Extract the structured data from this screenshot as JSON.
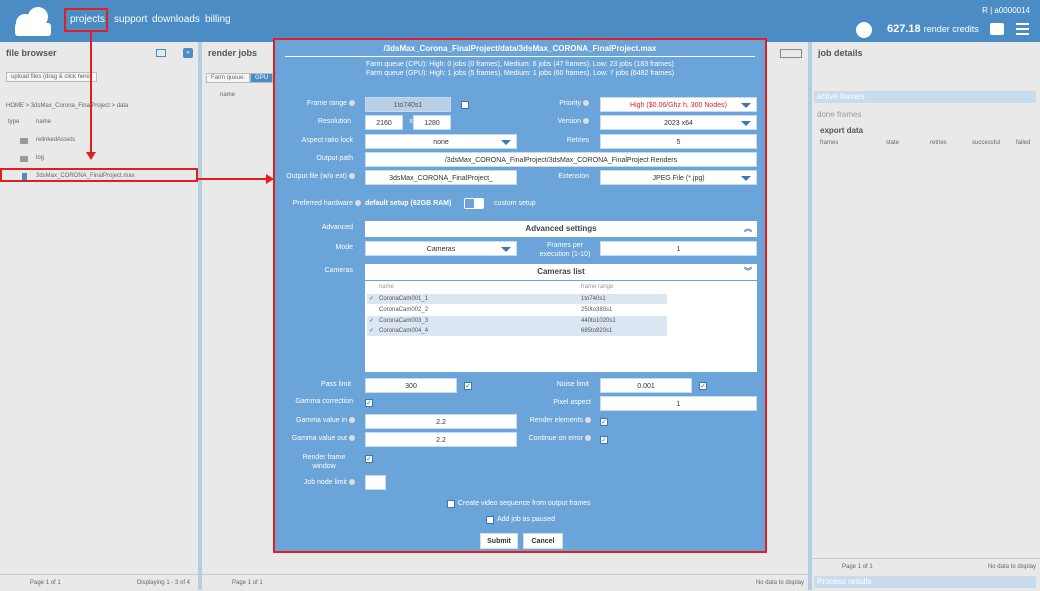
{
  "nav": {
    "projects": "projects",
    "support": "support",
    "downloads": "downloads",
    "billing": "billing"
  },
  "user": {
    "id": "R | a0000014",
    "credits_value": "627.18",
    "credits_label": "render credits"
  },
  "file_browser": {
    "title": "file browser",
    "upload": "upload files (drag & click here)",
    "breadcrumb": "HOME  >  3dsMax_Corona_FinalProject  >  data",
    "col_type": "type",
    "col_name": "name",
    "items": [
      "relinkedAssets",
      "log",
      "3dsMax_CORONA_FinalProject.max"
    ],
    "page_label": "Page",
    "page_num": "1",
    "of": "of 1",
    "displaying": "Displaying 1 - 3 of 4"
  },
  "render_jobs": {
    "title": "render jobs",
    "farm_queue": "Farm queue:",
    "gpu": "GPU",
    "col_name": "name",
    "page_label": "Page",
    "page_num": "1",
    "of": "of 1",
    "nodata": "No data to display"
  },
  "job_details": {
    "title": "job details",
    "active_frames": "active frames",
    "done_frames": "done frames",
    "export_data": "export data",
    "cols": [
      "frames",
      "state",
      "retries",
      "successful",
      "failed"
    ],
    "page_label": "Page",
    "page_num": "1",
    "of": "of 1",
    "nodata": "No data to display",
    "process_results": "Process results"
  },
  "modal": {
    "title": "/3dsMax_Corona_FinalProject/data/3dsMax_CORONA_FinalProject.max",
    "farm_cpu": "Farm queue (CPU): High: 0 jobs (0 frames), Medium: 6 jobs (47 frames), Low: 23 jobs (183 frames)",
    "farm_gpu": "Farm queue (GPU): High: 1 jobs (5 frames), Medium: 1 jobs (60 frames), Low: 7 jobs (6482 frames)",
    "frame_range_label": "Frame range",
    "frame_range": "1to740s1",
    "resolution_label": "Resolution",
    "res_w": "2160",
    "res_x": "x",
    "res_h": "1280",
    "aspect_label": "Aspect ratio lock",
    "aspect": "none",
    "output_path_label": "Output path",
    "output_path": "/3dsMax_CORONA_FinalProject/3dsMax_CORONA_FinalProject Renders",
    "output_file_label": "Output file (w/o ext)",
    "output_file": "3dsMax_CORONA_FinalProject_",
    "priority_label": "Priority",
    "priority": "High ($0.06/Ghz h, 300 Nodes)",
    "version_label": "Version",
    "version": "2023 x64",
    "retries_label": "Retries",
    "retries": "5",
    "extension_label": "Extension",
    "extension": "JPEG File (*.jpg)",
    "hardware_label": "Preferred hardware",
    "hardware_default": "default setup (62GB RAM)",
    "hardware_custom": "custom setup",
    "advanced_label": "Advanced",
    "advanced_settings": "Advanced settings",
    "mode_label": "Mode",
    "mode": "Cameras",
    "fpe_label": "Frames per execution (1-10)",
    "fpe": "1",
    "cameras_label": "Cameras",
    "cameras_list": "Cameras list",
    "cam_col_name": "name",
    "cam_col_range": "frame range",
    "cameras": [
      {
        "name": "CoronaCam001_1",
        "range": "1to740s1",
        "checked": true
      },
      {
        "name": "CoronaCam002_2",
        "range": "250to380s1",
        "checked": false
      },
      {
        "name": "CoronaCam003_3",
        "range": "440to1020s1",
        "checked": true
      },
      {
        "name": "CoronaCam004_4",
        "range": "685to920s1",
        "checked": true
      }
    ],
    "pass_limit_label": "Pass limit",
    "pass_limit": "300",
    "noise_limit_label": "Noise limit",
    "noise_limit": "0.001",
    "gamma_corr_label": "Gamma correction",
    "pixel_aspect_label": "Pixel aspect",
    "pixel_aspect": "1",
    "gamma_in_label": "Gamma value in",
    "gamma_in": "2.2",
    "render_elements_label": "Render elements",
    "gamma_out_label": "Gamma value out",
    "gamma_out": "2.2",
    "continue_error_label": "Continue on error",
    "render_frame_label": "Render frame window",
    "job_node_label": "Job node limit",
    "video_label": "Create video sequence from output frames",
    "paused_label": "Add job as paused",
    "submit": "Submit",
    "cancel": "Cancel"
  },
  "colors": {
    "topbar": "#4a8cc3",
    "modal": "#6aa4d9",
    "highlight": "#e02020",
    "priority": "#e02020"
  }
}
